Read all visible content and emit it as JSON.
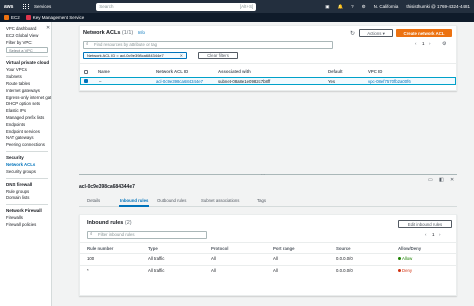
{
  "topbar": {
    "logo": "aws",
    "services_label": "Services",
    "search_placeholder": "Search",
    "search_shortcut": "[Alt+S]",
    "region": "N. California",
    "account": "thisisthumki @ 1769-4324-4481"
  },
  "subbar": {
    "services": [
      {
        "label": "EC2",
        "color": "#ec7211"
      },
      {
        "label": "Key Management Service",
        "color": "#dd344c"
      }
    ]
  },
  "sidebar": {
    "top_items": [
      "VPC dashboard",
      "EC2 Global View",
      "Filter by VPC:"
    ],
    "vpc_select_placeholder": "Select a VPC",
    "sections": [
      {
        "heading": "Virtual private cloud",
        "items": [
          "Your VPCs",
          "Subnets",
          "Route tables",
          "Internet gateways",
          "Egress-only internet gateways",
          "DHCP option sets",
          "Elastic IPs",
          "Managed prefix lists",
          "Endpoints",
          "Endpoint services",
          "NAT gateways",
          "Peering connections"
        ]
      },
      {
        "heading": "Security",
        "items": [
          "Network ACLs",
          "Security groups"
        ]
      },
      {
        "heading": "DNS firewall",
        "items": [
          "Rule groups",
          "Domain lists"
        ]
      },
      {
        "heading": "Network Firewall",
        "items": [
          "Firewalls",
          "Firewall policies"
        ]
      }
    ],
    "active_item": "Network ACLs"
  },
  "acl_panel": {
    "title": "Network ACLs",
    "count": "(1/1)",
    "info": "Info",
    "actions_label": "Actions",
    "create_label": "Create network ACL",
    "filter_placeholder": "Find resources by attribute or tag",
    "filter_chip": "Network ACL ID = acl-0c9e398ca684344e7",
    "clear_filters": "Clear filters",
    "page": "1",
    "columns": [
      "Name",
      "Network ACL ID",
      "Associated with",
      "Default",
      "VPC ID"
    ],
    "rows": [
      {
        "name": "–",
        "acl_id": "acl-0c9e398ca684344e7",
        "associated": "subnet-08a8e1e0982c7b8ff",
        "default": "Yes",
        "vpc_id": "vpc-08ef7570fb2a00f6"
      }
    ]
  },
  "detail_panel": {
    "title": "acl-0c9e398ca684344e7",
    "tabs": [
      "Details",
      "Inbound rules",
      "Outbound rules",
      "Subnet associations",
      "Tags"
    ],
    "active_tab": "Inbound rules",
    "inbound_title": "Inbound rules",
    "inbound_count": "(2)",
    "edit_label": "Edit inbound rules",
    "filter_placeholder": "Filter inbound rules",
    "page": "1",
    "columns": [
      "Rule number",
      "Type",
      "Protocol",
      "Port range",
      "Source",
      "Allow/Deny"
    ],
    "rows": [
      {
        "rule": "100",
        "type": "All traffic",
        "protocol": "All",
        "port": "All",
        "source": "0.0.0.0/0",
        "action": "Allow"
      },
      {
        "rule": "*",
        "type": "All traffic",
        "protocol": "All",
        "port": "All",
        "source": "0.0.0.0/0",
        "action": "Deny"
      }
    ]
  }
}
